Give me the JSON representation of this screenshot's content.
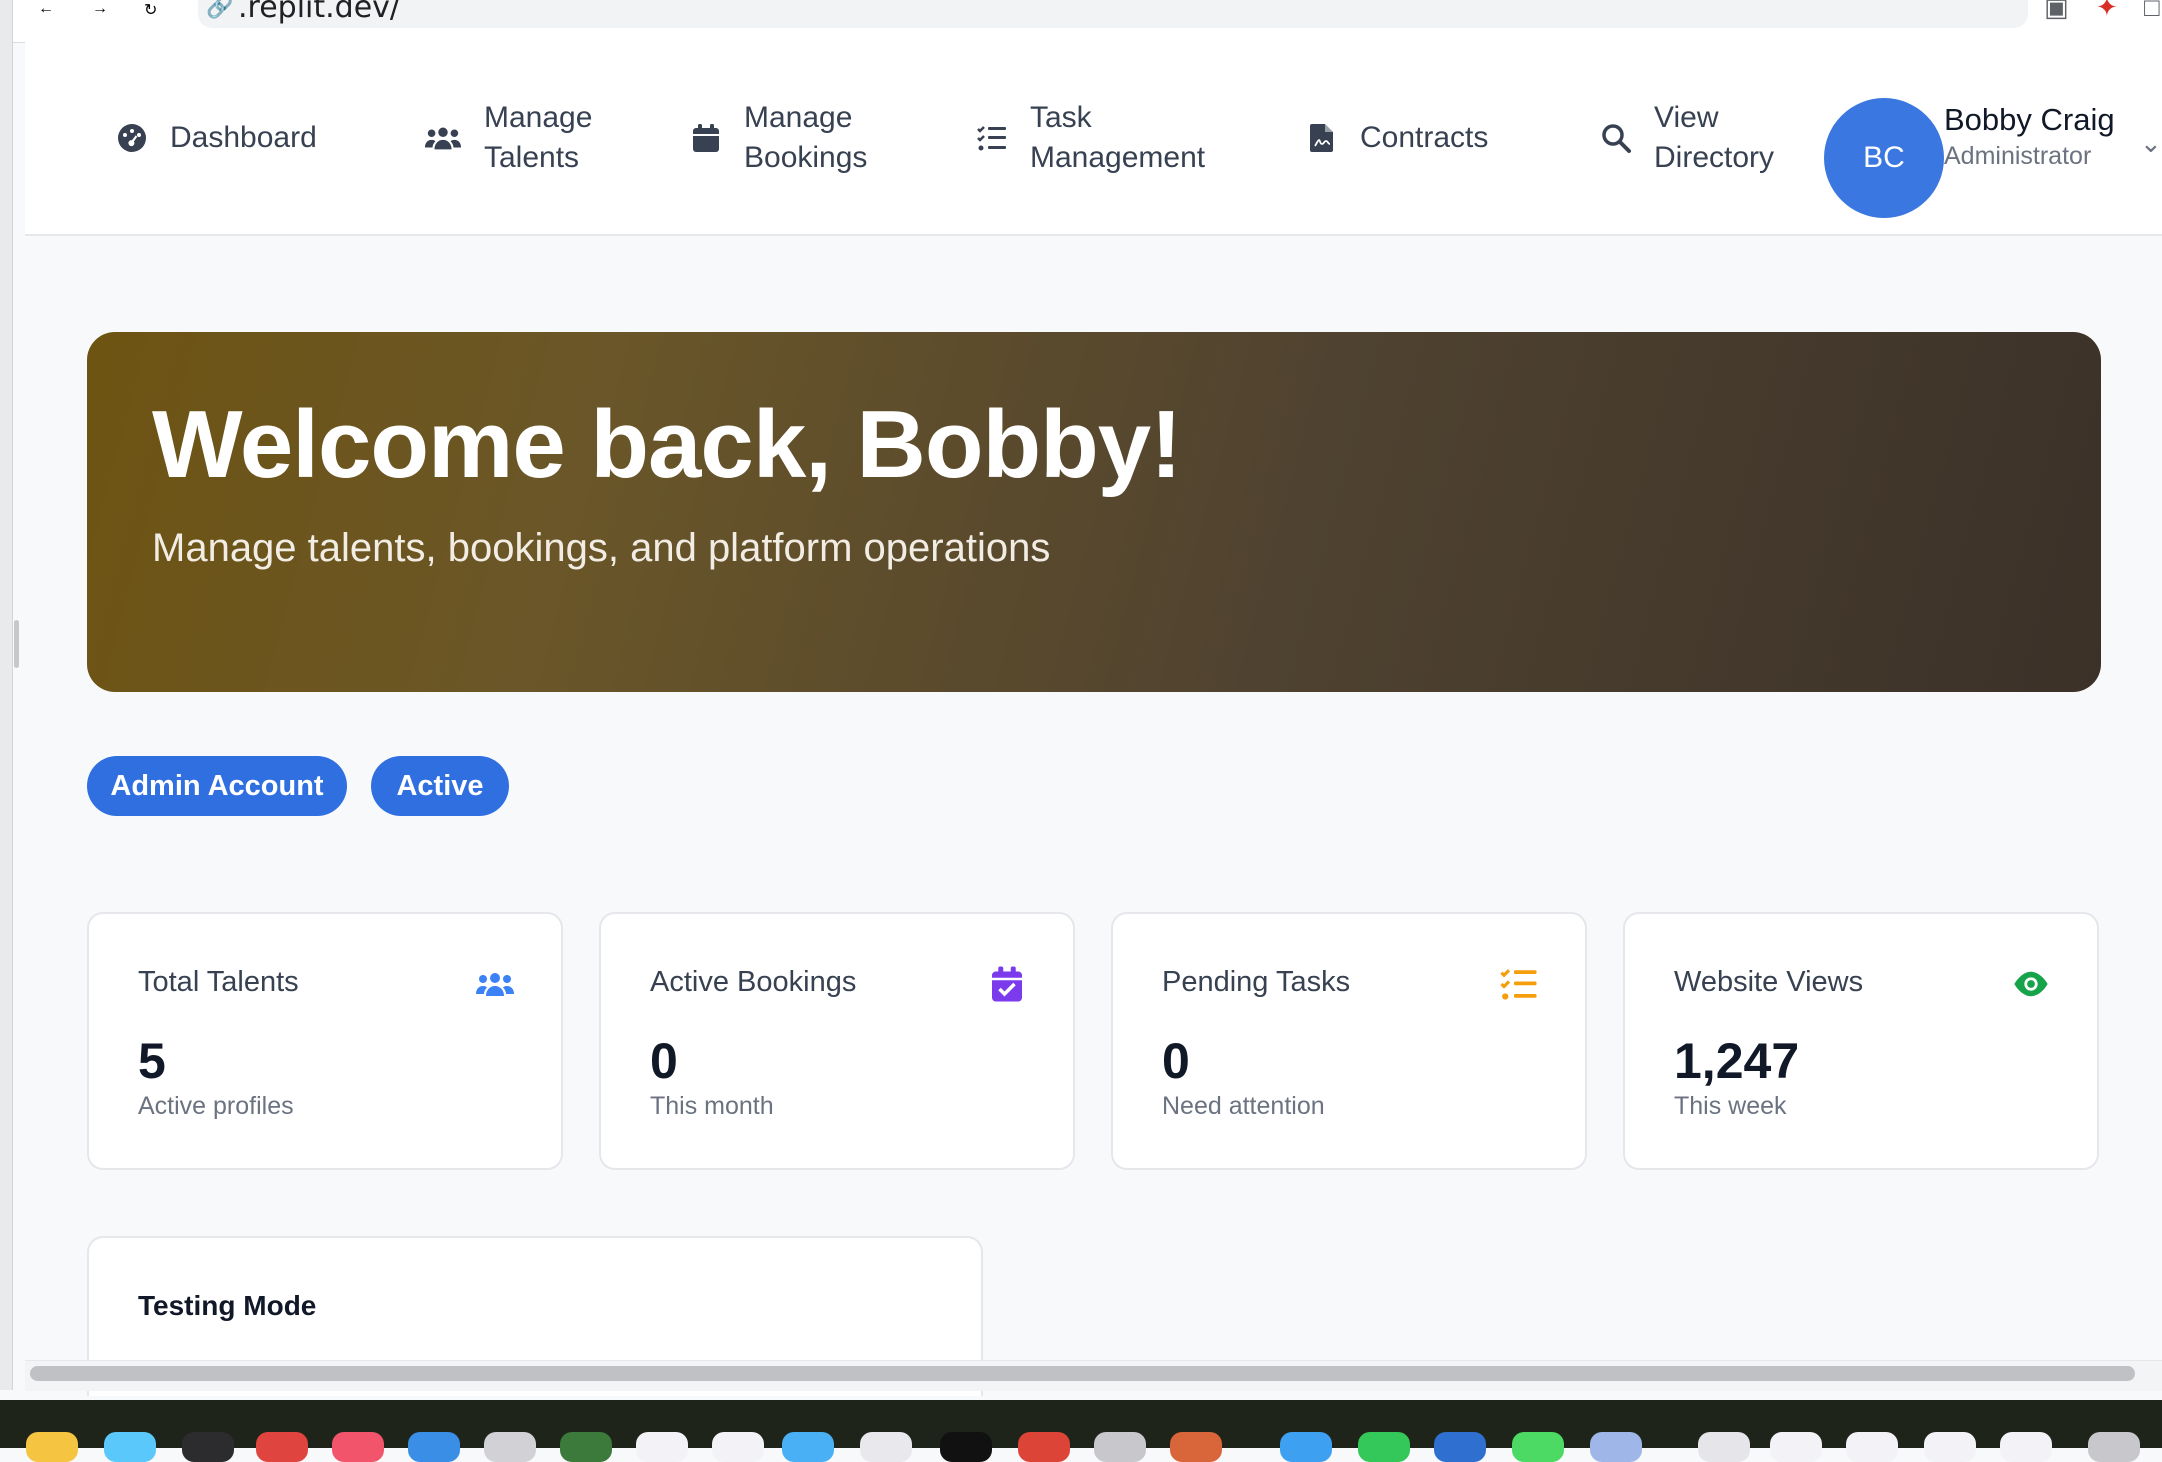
{
  "browser": {
    "url": ".replit.dev/"
  },
  "nav": {
    "items": [
      {
        "line1": "Dashboard",
        "line2": "",
        "icon": "gauge-icon"
      },
      {
        "line1": "Manage",
        "line2": "Talents",
        "icon": "users-icon"
      },
      {
        "line1": "Manage",
        "line2": "Bookings",
        "icon": "calendar-icon"
      },
      {
        "line1": "Task",
        "line2": "Management",
        "icon": "task-list-icon"
      },
      {
        "line1": "Contracts",
        "line2": "",
        "icon": "contract-icon"
      },
      {
        "line1": "View",
        "line2": "Directory",
        "icon": "search-icon"
      }
    ]
  },
  "user": {
    "initials": "BC",
    "name": "Bobby Craig",
    "role": "Administrator"
  },
  "hero": {
    "title": "Welcome back, Bobby!",
    "subtitle": "Manage talents, bookings, and platform operations"
  },
  "badges": [
    "Admin Account",
    "Active"
  ],
  "stats": [
    {
      "label": "Total Talents",
      "value": "5",
      "sub": "Active profiles",
      "icon": "users-icon",
      "color": "#3b82f6"
    },
    {
      "label": "Active Bookings",
      "value": "0",
      "sub": "This month",
      "icon": "calendar-check-icon",
      "color": "#7c3aed"
    },
    {
      "label": "Pending Tasks",
      "value": "0",
      "sub": "Need attention",
      "icon": "task-list-icon",
      "color": "#f59e0b"
    },
    {
      "label": "Website Views",
      "value": "1,247",
      "sub": "This week",
      "icon": "eye-icon",
      "color": "#16a34a"
    }
  ],
  "testing": {
    "title": "Testing Mode"
  },
  "colors": {
    "accent": "#2f6fe0",
    "hero_start": "#6e5412",
    "hero_end": "#3b3128"
  }
}
